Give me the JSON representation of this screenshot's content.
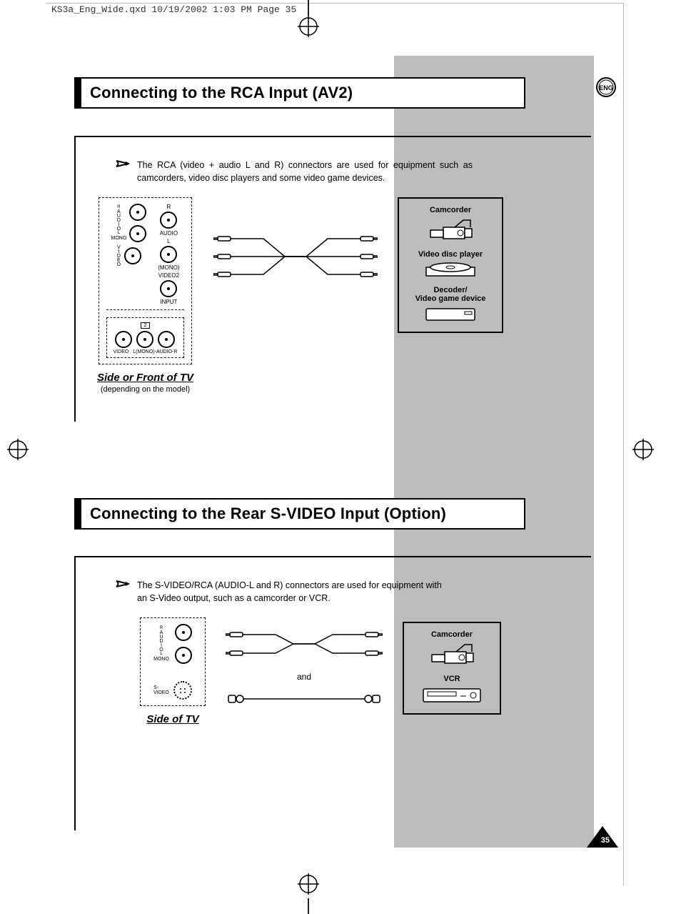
{
  "print_header": "KS3a_Eng_Wide.qxd  10/19/2002  1:03 PM  Page 35",
  "lang_badge": "ENG",
  "page_number": "35",
  "section1": {
    "title": "Connecting to the RCA Input (AV2)",
    "note": "The RCA (video + audio L and R) connectors are used for equipment such as camcorders, video disc players and some video game devices.",
    "panel_caption": "Side or Front of TV",
    "panel_sub": "(depending on the model)",
    "jack_labels": {
      "audio_v": "AUDIO",
      "mono": "MONO",
      "video_v": "VIDEO",
      "r": "R",
      "audio": "AUDIO",
      "l": "L",
      "mono_p": "(MONO)",
      "video2": "VIDEO2",
      "input": "INPUT",
      "row2_av": "2",
      "row2_video": "VIDEO",
      "row2_audio": "L(MONO)-AUDIO-R"
    },
    "devices": {
      "camcorder": "Camcorder",
      "discplayer": "Video disc player",
      "decoder1": "Decoder/",
      "decoder2": "Video game device"
    }
  },
  "section2": {
    "title": "Connecting to the Rear S-VIDEO Input (Option)",
    "note": "The S-VIDEO/RCA (AUDIO-L and R) connectors are used for equipment with an S-Video output, such as a camcorder or VCR.",
    "panel_caption": "Side of TV",
    "and_label": "and",
    "jack_labels": {
      "audio_v": "AUDIO",
      "mono": "MONO",
      "svideo": "S-\nVIDEO"
    },
    "devices": {
      "camcorder": "Camcorder",
      "vcr": "VCR"
    }
  }
}
